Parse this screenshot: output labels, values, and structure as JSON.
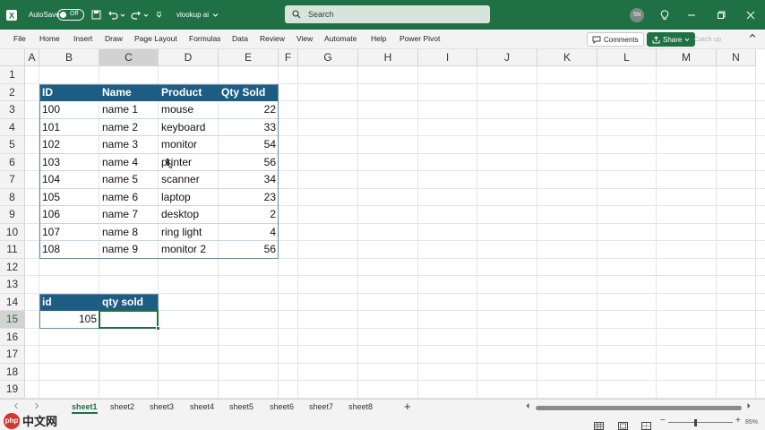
{
  "titlebar": {
    "autosave_label": "AutoSave",
    "autosave_state": "Off",
    "filename": "vlookup ai",
    "search_placeholder": "Search",
    "user_initials": "SN"
  },
  "ribbon": {
    "tabs": [
      "File",
      "Home",
      "Insert",
      "Draw",
      "Page Layout",
      "Formulas",
      "Data",
      "Review",
      "View",
      "Automate",
      "Help",
      "Power Pivot"
    ],
    "comments_label": "Comments",
    "share_label": "Share",
    "catchup_label": "Catch up"
  },
  "grid": {
    "columns": [
      "A",
      "B",
      "C",
      "D",
      "E",
      "F",
      "G",
      "H",
      "I",
      "J",
      "K",
      "L",
      "M",
      "N"
    ],
    "selected_column": "C",
    "rows": [
      "1",
      "2",
      "3",
      "4",
      "5",
      "6",
      "7",
      "8",
      "9",
      "10",
      "11",
      "12",
      "13",
      "14",
      "15",
      "16",
      "17",
      "18",
      "19"
    ],
    "selected_row": "15"
  },
  "table": {
    "headers": [
      "ID",
      "Name",
      "Product",
      "Qty Sold"
    ],
    "rows": [
      [
        "100",
        "name 1",
        "mouse",
        "22"
      ],
      [
        "101",
        "name 2",
        "keyboard",
        "33"
      ],
      [
        "102",
        "name 3",
        "monitor",
        "54"
      ],
      [
        "103",
        "name 4",
        "printer",
        "56"
      ],
      [
        "104",
        "name 5",
        "scanner",
        "34"
      ],
      [
        "105",
        "name 6",
        "laptop",
        "23"
      ],
      [
        "106",
        "name 7",
        "desktop",
        "2"
      ],
      [
        "107",
        "name 8",
        "ring light",
        "4"
      ],
      [
        "108",
        "name 9",
        "monitor 2",
        "56"
      ]
    ]
  },
  "lookup": {
    "headers": [
      "id",
      "qty sold"
    ],
    "id_value": "105",
    "qty_value": ""
  },
  "sheets": {
    "tabs": [
      "sheet1",
      "sheet2",
      "sheet3",
      "sheet4",
      "sheet5",
      "sheet6",
      "sheet7",
      "sheet8"
    ],
    "active": "sheet1"
  },
  "statusbar": {
    "zoom": "85%"
  },
  "watermark": {
    "logo_text": "php",
    "site_text": "中文网"
  },
  "colors": {
    "excel_green": "#1f7145",
    "table_header": "#1d5d84"
  }
}
